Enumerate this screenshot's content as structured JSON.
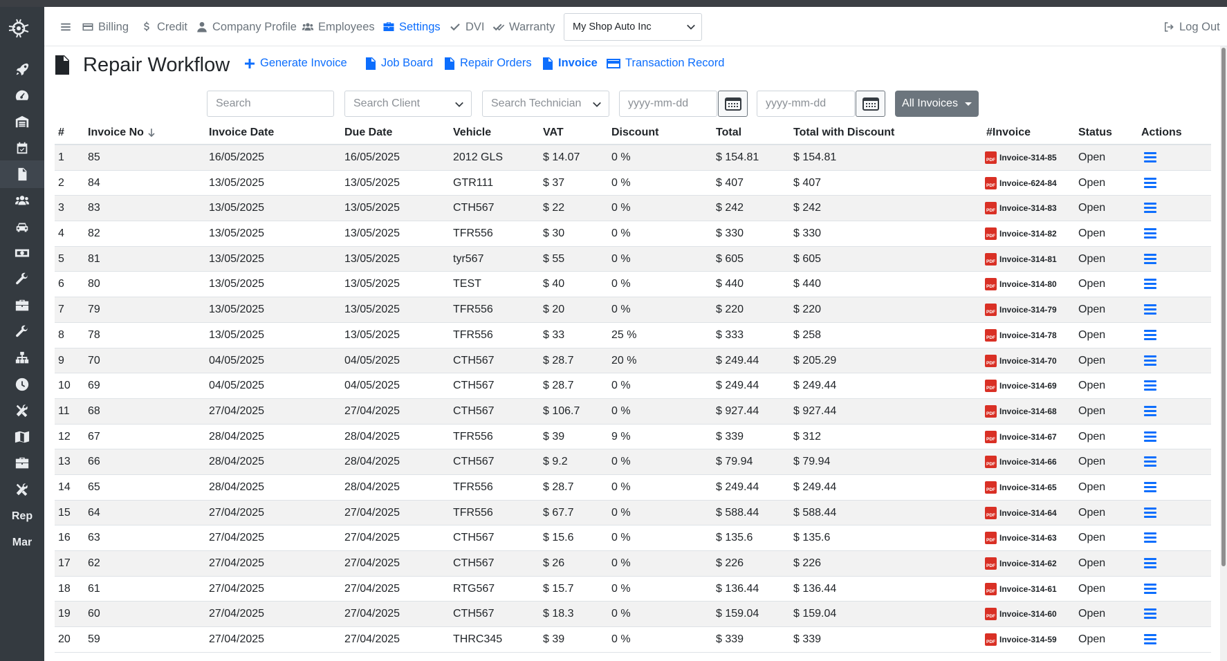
{
  "nav": {
    "billing": "Billing",
    "credit": "Credit",
    "company_profile": "Company Profile",
    "employees": "Employees",
    "settings": "Settings",
    "dvi": "DVI",
    "warranty": "Warranty",
    "shop_selected": "My Shop Auto Inc",
    "logout": "Log Out"
  },
  "sidebar": {
    "text_items": [
      "Rep",
      "Mar"
    ]
  },
  "header": {
    "title": "Repair Workflow",
    "generate_invoice": "Generate Invoice",
    "job_board": "Job Board",
    "repair_orders": "Repair Orders",
    "invoice": "Invoice",
    "transaction_record": "Transaction Record"
  },
  "filters": {
    "search_placeholder": "Search",
    "client_placeholder": "Search Client",
    "technician_placeholder": "Search Technician",
    "date_from_placeholder": "yyyy-mm-dd",
    "date_to_placeholder": "yyyy-mm-dd",
    "invoice_filter": "All Invoices"
  },
  "table": {
    "headers": {
      "num": "#",
      "invoice_no": "Invoice No",
      "invoice_date": "Invoice Date",
      "due_date": "Due Date",
      "vehicle": "Vehicle",
      "vat": "VAT",
      "discount": "Discount",
      "total": "Total",
      "total_with_discount": "Total with Discount",
      "invoice_file": "#Invoice",
      "status": "Status",
      "actions": "Actions"
    },
    "rows": [
      {
        "n": "1",
        "inv": "85",
        "idate": "16/05/2025",
        "ddate": "16/05/2025",
        "vehicle": "2012 GLS",
        "vat": "$ 14.07",
        "disc": "0 %",
        "total": "$ 154.81",
        "twd": "$ 154.81",
        "file": "Invoice-314-85",
        "status": "Open"
      },
      {
        "n": "2",
        "inv": "84",
        "idate": "13/05/2025",
        "ddate": "13/05/2025",
        "vehicle": "GTR111",
        "vat": "$ 37",
        "disc": "0 %",
        "total": "$ 407",
        "twd": "$ 407",
        "file": "Invoice-624-84",
        "status": "Open"
      },
      {
        "n": "3",
        "inv": "83",
        "idate": "13/05/2025",
        "ddate": "13/05/2025",
        "vehicle": "CTH567",
        "vat": "$ 22",
        "disc": "0 %",
        "total": "$ 242",
        "twd": "$ 242",
        "file": "Invoice-314-83",
        "status": "Open"
      },
      {
        "n": "4",
        "inv": "82",
        "idate": "13/05/2025",
        "ddate": "13/05/2025",
        "vehicle": "TFR556",
        "vat": "$ 30",
        "disc": "0 %",
        "total": "$ 330",
        "twd": "$ 330",
        "file": "Invoice-314-82",
        "status": "Open"
      },
      {
        "n": "5",
        "inv": "81",
        "idate": "13/05/2025",
        "ddate": "13/05/2025",
        "vehicle": "tyr567",
        "vat": "$ 55",
        "disc": "0 %",
        "total": "$ 605",
        "twd": "$ 605",
        "file": "Invoice-314-81",
        "status": "Open"
      },
      {
        "n": "6",
        "inv": "80",
        "idate": "13/05/2025",
        "ddate": "13/05/2025",
        "vehicle": "TEST",
        "vat": "$ 40",
        "disc": "0 %",
        "total": "$ 440",
        "twd": "$ 440",
        "file": "Invoice-314-80",
        "status": "Open"
      },
      {
        "n": "7",
        "inv": "79",
        "idate": "13/05/2025",
        "ddate": "13/05/2025",
        "vehicle": "TFR556",
        "vat": "$ 20",
        "disc": "0 %",
        "total": "$ 220",
        "twd": "$ 220",
        "file": "Invoice-314-79",
        "status": "Open"
      },
      {
        "n": "8",
        "inv": "78",
        "idate": "13/05/2025",
        "ddate": "13/05/2025",
        "vehicle": "TFR556",
        "vat": "$ 33",
        "disc": "25 %",
        "total": "$ 333",
        "twd": "$ 258",
        "file": "Invoice-314-78",
        "status": "Open"
      },
      {
        "n": "9",
        "inv": "70",
        "idate": "04/05/2025",
        "ddate": "04/05/2025",
        "vehicle": "CTH567",
        "vat": "$ 28.7",
        "disc": "20 %",
        "total": "$ 249.44",
        "twd": "$ 205.29",
        "file": "Invoice-314-70",
        "status": "Open"
      },
      {
        "n": "10",
        "inv": "69",
        "idate": "04/05/2025",
        "ddate": "04/05/2025",
        "vehicle": "CTH567",
        "vat": "$ 28.7",
        "disc": "0 %",
        "total": "$ 249.44",
        "twd": "$ 249.44",
        "file": "Invoice-314-69",
        "status": "Open"
      },
      {
        "n": "11",
        "inv": "68",
        "idate": "27/04/2025",
        "ddate": "27/04/2025",
        "vehicle": "CTH567",
        "vat": "$ 106.7",
        "disc": "0 %",
        "total": "$ 927.44",
        "twd": "$ 927.44",
        "file": "Invoice-314-68",
        "status": "Open"
      },
      {
        "n": "12",
        "inv": "67",
        "idate": "28/04/2025",
        "ddate": "28/04/2025",
        "vehicle": "TFR556",
        "vat": "$ 39",
        "disc": "9 %",
        "total": "$ 339",
        "twd": "$ 312",
        "file": "Invoice-314-67",
        "status": "Open"
      },
      {
        "n": "13",
        "inv": "66",
        "idate": "28/04/2025",
        "ddate": "28/04/2025",
        "vehicle": "CTH567",
        "vat": "$ 9.2",
        "disc": "0 %",
        "total": "$ 79.94",
        "twd": "$ 79.94",
        "file": "Invoice-314-66",
        "status": "Open"
      },
      {
        "n": "14",
        "inv": "65",
        "idate": "28/04/2025",
        "ddate": "28/04/2025",
        "vehicle": "TFR556",
        "vat": "$ 28.7",
        "disc": "0 %",
        "total": "$ 249.44",
        "twd": "$ 249.44",
        "file": "Invoice-314-65",
        "status": "Open"
      },
      {
        "n": "15",
        "inv": "64",
        "idate": "27/04/2025",
        "ddate": "27/04/2025",
        "vehicle": "TFR556",
        "vat": "$ 67.7",
        "disc": "0 %",
        "total": "$ 588.44",
        "twd": "$ 588.44",
        "file": "Invoice-314-64",
        "status": "Open"
      },
      {
        "n": "16",
        "inv": "63",
        "idate": "27/04/2025",
        "ddate": "27/04/2025",
        "vehicle": "CTH567",
        "vat": "$ 15.6",
        "disc": "0 %",
        "total": "$ 135.6",
        "twd": "$ 135.6",
        "file": "Invoice-314-63",
        "status": "Open"
      },
      {
        "n": "17",
        "inv": "62",
        "idate": "27/04/2025",
        "ddate": "27/04/2025",
        "vehicle": "CTH567",
        "vat": "$ 26",
        "disc": "0 %",
        "total": "$ 226",
        "twd": "$ 226",
        "file": "Invoice-314-62",
        "status": "Open"
      },
      {
        "n": "18",
        "inv": "61",
        "idate": "27/04/2025",
        "ddate": "27/04/2025",
        "vehicle": "RTG567",
        "vat": "$ 15.7",
        "disc": "0 %",
        "total": "$ 136.44",
        "twd": "$ 136.44",
        "file": "Invoice-314-61",
        "status": "Open"
      },
      {
        "n": "19",
        "inv": "60",
        "idate": "27/04/2025",
        "ddate": "27/04/2025",
        "vehicle": "CTH567",
        "vat": "$ 18.3",
        "disc": "0 %",
        "total": "$ 159.04",
        "twd": "$ 159.04",
        "file": "Invoice-314-60",
        "status": "Open"
      },
      {
        "n": "20",
        "inv": "59",
        "idate": "27/04/2025",
        "ddate": "27/04/2025",
        "vehicle": "THRC345",
        "vat": "$ 39",
        "disc": "0 %",
        "total": "$ 339",
        "twd": "$ 339",
        "file": "Invoice-314-59",
        "status": "Open"
      }
    ]
  },
  "colors": {
    "accent": "#0d6efd",
    "sidebar_bg": "#343a40",
    "pdf_red": "#d93025",
    "filter_button": "#6c757d"
  },
  "icons": {
    "pdf_label": "PDF"
  }
}
